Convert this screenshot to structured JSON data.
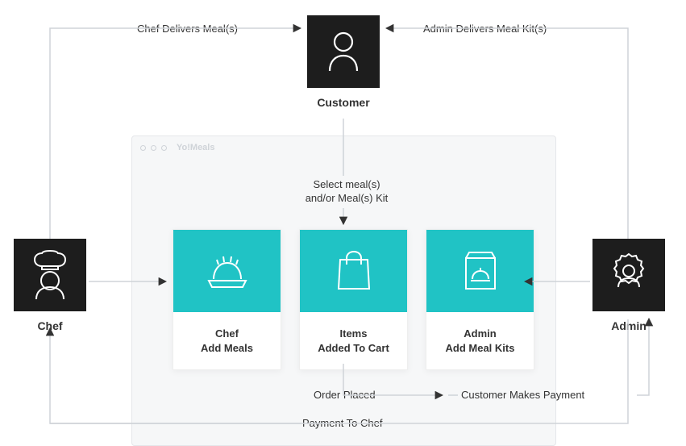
{
  "app": {
    "title": "Yo!Meals"
  },
  "actors": {
    "customer": {
      "label": "Customer"
    },
    "chef": {
      "label": "Chef"
    },
    "admin": {
      "label": "Admin"
    }
  },
  "cards": {
    "chef_add": {
      "label": "Chef\nAdd Meals"
    },
    "cart": {
      "label": "Items\nAdded To Cart"
    },
    "admin_add": {
      "label": "Admin\nAdd Meal Kits"
    }
  },
  "edges": {
    "chef_delivers": "Chef Delivers Meal(s)",
    "admin_delivers": "Admin Delivers Meal Kit(s)",
    "select_meals": "Select meal(s)\nand/or Meal(s) Kit",
    "order_placed": "Order Placed",
    "customer_pays": "Customer Makes Payment",
    "payment_to_chef": "Payment To Chef"
  },
  "colors": {
    "accent": "#20c3c5",
    "dark": "#1d1d1d"
  },
  "chart_data": {
    "type": "flow-diagram",
    "nodes": [
      {
        "id": "customer",
        "label": "Customer",
        "kind": "actor"
      },
      {
        "id": "chef",
        "label": "Chef",
        "kind": "actor"
      },
      {
        "id": "admin",
        "label": "Admin",
        "kind": "actor"
      },
      {
        "id": "app",
        "label": "Yo!Meals",
        "kind": "container"
      },
      {
        "id": "chef_add",
        "label": "Chef Add Meals",
        "kind": "step",
        "parent": "app"
      },
      {
        "id": "cart",
        "label": "Items Added To Cart",
        "kind": "step",
        "parent": "app"
      },
      {
        "id": "admin_add",
        "label": "Admin Add Meal Kits",
        "kind": "step",
        "parent": "app"
      }
    ],
    "edges": [
      {
        "from": "chef",
        "to": "customer",
        "label": "Chef Delivers Meal(s)"
      },
      {
        "from": "admin",
        "to": "customer",
        "label": "Admin Delivers Meal Kit(s)"
      },
      {
        "from": "customer",
        "to": "cart",
        "label": "Select meal(s) and/or Meal(s) Kit"
      },
      {
        "from": "chef",
        "to": "chef_add",
        "label": ""
      },
      {
        "from": "admin",
        "to": "admin_add",
        "label": ""
      },
      {
        "from": "cart",
        "to": "admin",
        "label": "Order Placed"
      },
      {
        "from": "admin",
        "to": "admin",
        "label": "Customer Makes Payment"
      },
      {
        "from": "admin",
        "to": "chef",
        "label": "Payment To Chef"
      }
    ]
  }
}
